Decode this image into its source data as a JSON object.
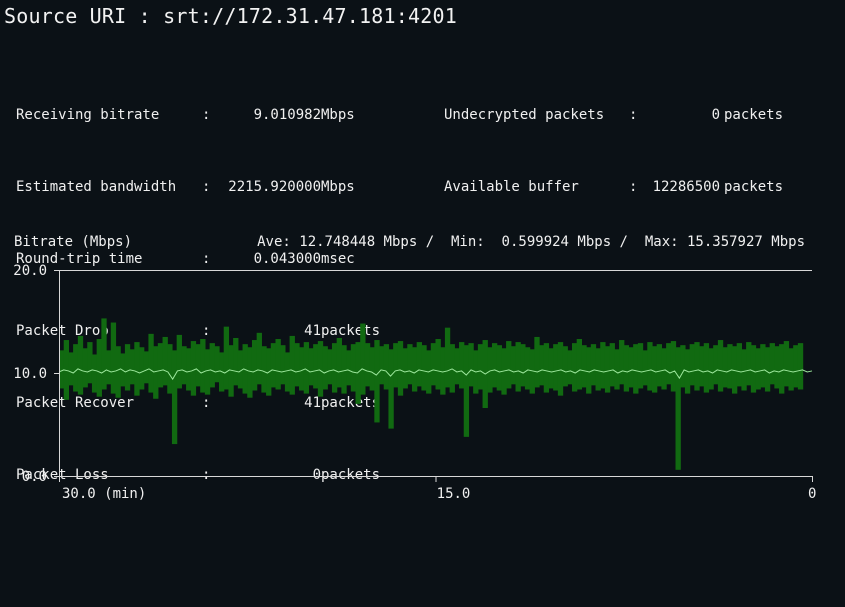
{
  "source": {
    "label": "Source URI",
    "separator": ":",
    "uri": "srt://172.31.47.181:4201"
  },
  "stats_left": [
    {
      "label": "Receiving bitrate",
      "sep": ":",
      "value": "9.010982",
      "unit": "Mbps"
    },
    {
      "label": "Estimated bandwidth",
      "sep": ":",
      "value": "2215.920000",
      "unit": "Mbps"
    },
    {
      "label": "Round-trip time",
      "sep": ":",
      "value": "0.043000",
      "unit": "msec"
    },
    {
      "label": "Packet Drop",
      "sep": ":",
      "value": "41",
      "unit": "packets"
    },
    {
      "label": "Packet Recover",
      "sep": ":",
      "value": "41",
      "unit": "packets"
    },
    {
      "label": "Packet Loss",
      "sep": ":",
      "value": "0",
      "unit": "packets"
    }
  ],
  "stats_right": [
    {
      "label": "Undecrypted packets",
      "sep": ":",
      "value": "0",
      "unit": "packets"
    },
    {
      "label": "Available buffer",
      "sep": ":",
      "value": "12286500",
      "unit": "packets"
    }
  ],
  "chart_header": {
    "title": "Bitrate (Mbps)",
    "summary": "Ave: 12.748448 Mbps /  Min:  0.599924 Mbps /  Max: 15.357927 Mbps"
  },
  "chart_data": {
    "type": "bar",
    "title": "Bitrate (Mbps)",
    "xlabel": "(min)",
    "ylabel": "",
    "ylim": [
      0,
      20
    ],
    "xlim": [
      30,
      0
    ],
    "y_ticks": [
      "0.0",
      "10.0",
      "20.0"
    ],
    "x_ticks": [
      "30.0 (min)",
      "15.0",
      "0"
    ],
    "grid": false,
    "colors": {
      "range_band": "#116a11",
      "average_line": "#9ce79c",
      "axis": "#d8d8d8"
    },
    "series": [
      {
        "name": "",
        "description_values": "per-sample max (top) and min (bottom) of bitrate in Mbps across the 30-minute window",
        "max": [
          12.2,
          13.2,
          12.0,
          12.8,
          13.6,
          12.4,
          13.0,
          11.8,
          13.3,
          15.3,
          12.2,
          14.9,
          12.6,
          11.9,
          12.8,
          12.3,
          13.0,
          12.5,
          12.1,
          13.8,
          12.6,
          12.9,
          13.5,
          12.8,
          12.2,
          13.7,
          12.6,
          12.4,
          13.1,
          12.8,
          13.3,
          12.3,
          12.9,
          12.6,
          12.0,
          14.5,
          12.7,
          13.4,
          12.2,
          12.8,
          12.5,
          13.2,
          13.9,
          12.6,
          12.4,
          12.9,
          13.3,
          12.7,
          12.0,
          13.6,
          12.9,
          12.5,
          13.0,
          12.4,
          12.8,
          13.1,
          12.6,
          12.3,
          12.9,
          13.4,
          12.7,
          12.2,
          12.8,
          13.0,
          14.8,
          12.9,
          12.5,
          13.2,
          12.6,
          12.8,
          12.3,
          12.9,
          13.1,
          12.4,
          12.8,
          12.5,
          13.0,
          12.7,
          12.2,
          12.9,
          13.3,
          12.5,
          14.4,
          12.8,
          12.4,
          13.0,
          12.7,
          12.9,
          12.2,
          12.8,
          13.2,
          12.5,
          12.9,
          12.7,
          12.4,
          13.1,
          12.6,
          13.0,
          12.8,
          12.5,
          12.3,
          13.5,
          12.7,
          12.9,
          12.4,
          12.8,
          13.0,
          12.6,
          12.2,
          12.9,
          13.3,
          12.7,
          12.5,
          12.8,
          12.4,
          13.0,
          12.6,
          12.9,
          12.3,
          13.2,
          12.7,
          12.5,
          12.8,
          12.9,
          12.2,
          13.0,
          12.6,
          12.8,
          12.4,
          12.9,
          13.1,
          12.5,
          12.7,
          12.3,
          12.8,
          13.0,
          12.6,
          12.9,
          12.4,
          12.7,
          13.2,
          12.5,
          12.8,
          12.6,
          12.9,
          12.3,
          13.0,
          12.7,
          12.4,
          12.8,
          12.5,
          12.9,
          12.6,
          12.8,
          13.1,
          12.4,
          12.7,
          12.9,
          12.5,
          12.8
        ],
        "min": [
          8.5,
          7.4,
          8.8,
          8.2,
          7.9,
          8.6,
          9.0,
          8.1,
          7.7,
          8.4,
          8.9,
          8.0,
          7.6,
          8.7,
          8.3,
          8.9,
          7.8,
          8.4,
          9.0,
          8.1,
          7.5,
          8.6,
          8.8,
          8.0,
          7.2,
          8.5,
          8.9,
          8.3,
          7.8,
          8.7,
          8.1,
          7.9,
          8.6,
          9.1,
          8.2,
          8.4,
          7.7,
          8.8,
          8.5,
          8.0,
          7.6,
          8.3,
          8.9,
          8.1,
          7.8,
          8.6,
          8.4,
          8.9,
          8.2,
          7.9,
          8.7,
          8.3,
          8.0,
          8.8,
          8.5,
          7.7,
          8.4,
          8.9,
          8.1,
          8.6,
          8.0,
          8.8,
          8.2,
          8.5,
          7.9,
          8.7,
          8.3,
          8.1,
          8.9,
          8.4,
          8.0,
          8.6,
          7.8,
          8.5,
          8.9,
          8.2,
          8.7,
          8.3,
          8.0,
          8.8,
          8.4,
          7.9,
          8.6,
          8.1,
          8.9,
          8.5,
          8.2,
          8.7,
          8.0,
          8.4,
          8.8,
          8.1,
          8.6,
          8.3,
          7.9,
          8.5,
          8.9,
          8.2,
          8.7,
          8.4,
          8.0,
          8.6,
          8.8,
          8.1,
          8.5,
          8.3,
          7.8,
          8.7,
          8.9,
          8.2,
          8.4,
          8.6,
          8.0,
          8.8,
          8.3,
          8.5,
          8.1,
          8.7,
          8.4,
          8.9,
          8.2,
          8.6,
          8.0,
          8.5,
          8.8,
          8.3,
          8.1,
          8.7,
          8.4,
          8.9,
          8.2,
          8.5,
          8.6,
          8.0,
          8.8,
          8.3,
          8.7,
          8.1,
          8.4,
          8.9,
          8.2,
          8.6,
          8.5,
          8.0,
          8.7,
          8.3,
          8.8,
          8.1,
          8.4,
          8.6,
          8.2,
          8.9,
          8.5,
          8.0,
          8.7,
          8.3,
          8.6,
          8.4
        ],
        "dips": [
          {
            "index": 24,
            "value": 3.1
          },
          {
            "index": 67,
            "value": 5.2
          },
          {
            "index": 70,
            "value": 4.6
          },
          {
            "index": 86,
            "value": 3.8
          },
          {
            "index": 90,
            "value": 6.6
          },
          {
            "index": 131,
            "value": 0.6
          },
          {
            "index": 63,
            "value": 7.0
          }
        ],
        "average_line": [
          10.1,
          10.3,
          10.2,
          10.0,
          10.4,
          10.2,
          10.1,
          10.3,
          10.2,
          10.0,
          10.3,
          10.1,
          10.2,
          10.4,
          10.1,
          10.3,
          10.2,
          10.0,
          10.2,
          10.4,
          10.1,
          10.2,
          10.3,
          10.1,
          9.4,
          10.2,
          10.3,
          10.1,
          10.2,
          10.4,
          10.0,
          10.2,
          10.3,
          10.1,
          10.2,
          10.0,
          10.3,
          10.2,
          10.1,
          10.4,
          10.2,
          10.1,
          10.3,
          10.2,
          10.0,
          10.3,
          10.2,
          10.1,
          10.2,
          10.3,
          10.1,
          10.2,
          10.4,
          10.1,
          10.2,
          10.3,
          10.0,
          10.2,
          10.3,
          10.1,
          10.2,
          10.3,
          10.1,
          10.0,
          10.4,
          10.2,
          10.1,
          9.8,
          10.3,
          10.2,
          9.7,
          10.2,
          10.3,
          10.1,
          10.2,
          10.0,
          10.3,
          10.2,
          10.1,
          10.3,
          10.2,
          10.1,
          10.2,
          10.4,
          10.1,
          10.2,
          9.8,
          10.3,
          10.1,
          10.2,
          9.9,
          10.2,
          10.3,
          10.1,
          10.2,
          10.3,
          10.1,
          10.2,
          10.0,
          10.3,
          10.2,
          10.1,
          10.3,
          10.2,
          10.1,
          10.2,
          10.3,
          10.1,
          10.2,
          10.0,
          10.3,
          10.2,
          10.1,
          10.3,
          10.2,
          10.1,
          10.2,
          10.3,
          10.0,
          10.2,
          10.1,
          10.3,
          10.2,
          10.1,
          10.2,
          10.3,
          10.1,
          10.2,
          10.3,
          10.0,
          10.2,
          9.5,
          10.3,
          10.1,
          10.2,
          10.3,
          10.1,
          10.2,
          10.0,
          10.3,
          10.2,
          10.1,
          10.3,
          10.2,
          10.1,
          10.2,
          10.3,
          10.1,
          10.2,
          10.3,
          10.0,
          10.2,
          10.1,
          10.3,
          10.2,
          10.1,
          10.2,
          10.3,
          10.1,
          10.2
        ]
      }
    ]
  }
}
